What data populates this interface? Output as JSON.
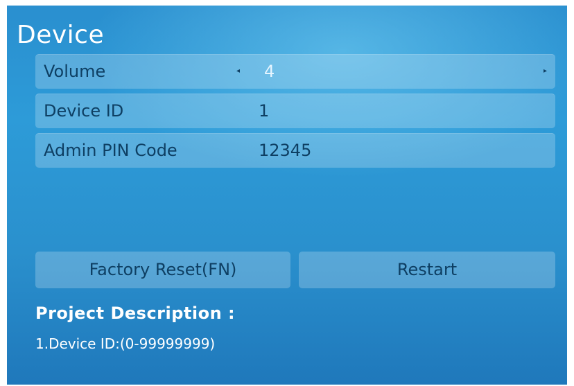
{
  "screen": {
    "title": "Device",
    "settings": [
      {
        "label": "Volume",
        "value": "4",
        "left_arrow": "◂",
        "right_arrow": "▸"
      },
      {
        "label": "Device ID",
        "value": "1"
      },
      {
        "label": "Admin PIN Code",
        "value": "12345"
      }
    ],
    "buttons": {
      "factory_reset": "Factory Reset(FN)",
      "restart": "Restart"
    },
    "description": {
      "title": "Project Description :",
      "line1": "1.Device ID:(0-99999999)"
    }
  },
  "colors": {
    "background": "#2a90cd",
    "row_bg": "rgba(255,255,255,0.22)",
    "text_dark": "#0e3f63",
    "text_light": "#ffffff"
  }
}
